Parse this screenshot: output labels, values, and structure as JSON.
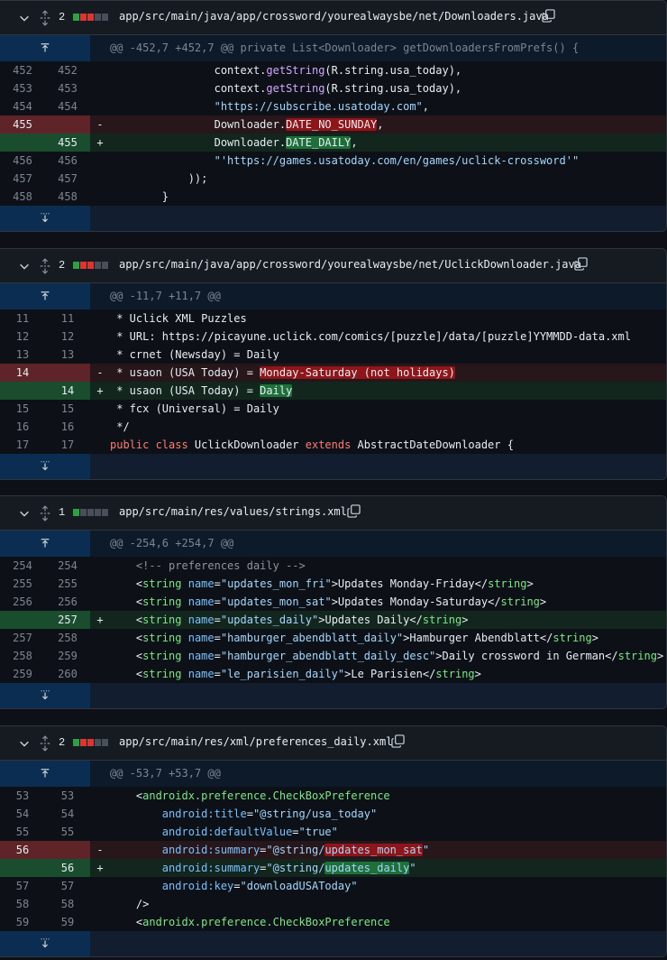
{
  "files": [
    {
      "count": "2",
      "blocks": [
        "g",
        "r",
        "r",
        "n",
        "n"
      ],
      "path": "app/src/main/java/app/crossword/yourealwaysbe/net/Downloaders.java",
      "hunk": "@@ -452,7 +452,7 @@ private List<Downloader> getDownloadersFromPrefs() {"
    },
    {
      "count": "2",
      "blocks": [
        "g",
        "r",
        "r",
        "n",
        "n"
      ],
      "path": "app/src/main/java/app/crossword/yourealwaysbe/net/UclickDownloader.java",
      "hunk": "@@ -11,7 +11,7 @@"
    },
    {
      "count": "1",
      "blocks": [
        "g",
        "n",
        "n",
        "n",
        "n"
      ],
      "path": "app/src/main/res/values/strings.xml",
      "hunk": "@@ -254,6 +254,7 @@"
    },
    {
      "count": "2",
      "blocks": [
        "g",
        "r",
        "r",
        "n",
        "n"
      ],
      "path": "app/src/main/res/xml/preferences_daily.xml",
      "hunk": "@@ -53,7 +53,7 @@"
    }
  ],
  "f1": {
    "rows": [
      {
        "o": "452",
        "n": "452",
        "s": "",
        "t": "                context.",
        "f": "getString",
        "r": "(R.string.usa_today),"
      },
      {
        "o": "453",
        "n": "453",
        "s": "",
        "t": "                context.",
        "f": "getString",
        "r": "(R.string.usa_today),"
      },
      {
        "o": "454",
        "n": "454",
        "s": "",
        "t": "                ",
        "str": "\"https://subscribe.usatoday.com\"",
        "r": ","
      },
      {
        "o": "455",
        "n": "",
        "s": "-",
        "t": "                Downloader.",
        "hl": "DATE_NO_SUNDAY",
        "r": ","
      },
      {
        "o": "",
        "n": "455",
        "s": "+",
        "t": "                Downloader.",
        "hl": "DATE_DAILY",
        "r": ","
      },
      {
        "o": "456",
        "n": "456",
        "s": "",
        "t": "                ",
        "str": "\"'https://games.usatoday.com/en/games/uclick-crossword'\""
      },
      {
        "o": "457",
        "n": "457",
        "s": "",
        "t": "            ));"
      },
      {
        "o": "458",
        "n": "458",
        "s": "",
        "t": "        }"
      }
    ]
  },
  "f2": {
    "rows": [
      {
        "o": "11",
        "n": "11",
        "s": "",
        "t": " * Uclick XML Puzzles"
      },
      {
        "o": "12",
        "n": "12",
        "s": "",
        "t": " * URL: https://picayune.uclick.com/comics/[puzzle]/data/[puzzle]YYMMDD-data.xml"
      },
      {
        "o": "13",
        "n": "13",
        "s": "",
        "t": " * crnet (Newsday) = Daily"
      },
      {
        "o": "14",
        "n": "",
        "s": "-",
        "t": " * usaon (USA Today) = ",
        "hl": "Monday-Saturday (not holidays)"
      },
      {
        "o": "",
        "n": "14",
        "s": "+",
        "t": " * usaon (USA Today) = ",
        "hl": "Daily"
      },
      {
        "o": "15",
        "n": "15",
        "s": "",
        "t": " * fcx (Universal) = Daily"
      },
      {
        "o": "16",
        "n": "16",
        "s": "",
        "t": " */"
      },
      {
        "o": "17",
        "n": "17",
        "s": "",
        "kw1": "public class",
        "mid": " UclickDownloader ",
        "kw2": "extends",
        "end": " AbstractDateDownloader {"
      }
    ]
  },
  "f3": {
    "rows": [
      {
        "o": "254",
        "n": "254",
        "s": "",
        "cm": "    <!-- preferences daily -->"
      },
      {
        "o": "255",
        "n": "255",
        "s": "",
        "name": "updates_mon_fri",
        "val": "Updates Monday-Friday"
      },
      {
        "o": "256",
        "n": "256",
        "s": "",
        "name": "updates_mon_sat",
        "val": "Updates Monday-Saturday"
      },
      {
        "o": "",
        "n": "257",
        "s": "+",
        "name": "updates_daily",
        "val": "Updates Daily"
      },
      {
        "o": "257",
        "n": "258",
        "s": "",
        "name": "hamburger_abendblatt_daily",
        "val": "Hamburger Abendblatt"
      },
      {
        "o": "258",
        "n": "259",
        "s": "",
        "name": "hamburger_abendblatt_daily_desc",
        "val": "Daily crossword in German"
      },
      {
        "o": "259",
        "n": "260",
        "s": "",
        "name": "le_parisien_daily",
        "val": "Le Parisien"
      }
    ]
  },
  "f4": {
    "rows": [
      {
        "o": "53",
        "n": "53",
        "s": "",
        "t": "    <",
        "tag": "androidx.preference.CheckBoxPreference"
      },
      {
        "o": "54",
        "n": "54",
        "s": "",
        "t": "        ",
        "a": "android:title",
        "v": "\"@string/usa_today\""
      },
      {
        "o": "55",
        "n": "55",
        "s": "",
        "t": "        ",
        "a": "android:defaultValue",
        "v": "\"true\""
      },
      {
        "o": "56",
        "n": "",
        "s": "-",
        "t": "        ",
        "a": "android:summary",
        "v1": "\"@string/",
        "hl": "updates_mon_sat",
        "v2": "\""
      },
      {
        "o": "",
        "n": "56",
        "s": "+",
        "t": "        ",
        "a": "android:summary",
        "v1": "\"@string/",
        "hl": "updates_daily",
        "v2": "\""
      },
      {
        "o": "57",
        "n": "57",
        "s": "",
        "t": "        ",
        "a": "android:key",
        "v": "\"downloadUSAToday\""
      },
      {
        "o": "58",
        "n": "58",
        "s": "",
        "t": "    />"
      },
      {
        "o": "59",
        "n": "59",
        "s": "",
        "t": "    <",
        "tag": "androidx.preference.CheckBoxPreference"
      }
    ]
  },
  "colors": {
    "added": "#2ea043",
    "removed": "#da3633",
    "neutral": "#484f58"
  }
}
